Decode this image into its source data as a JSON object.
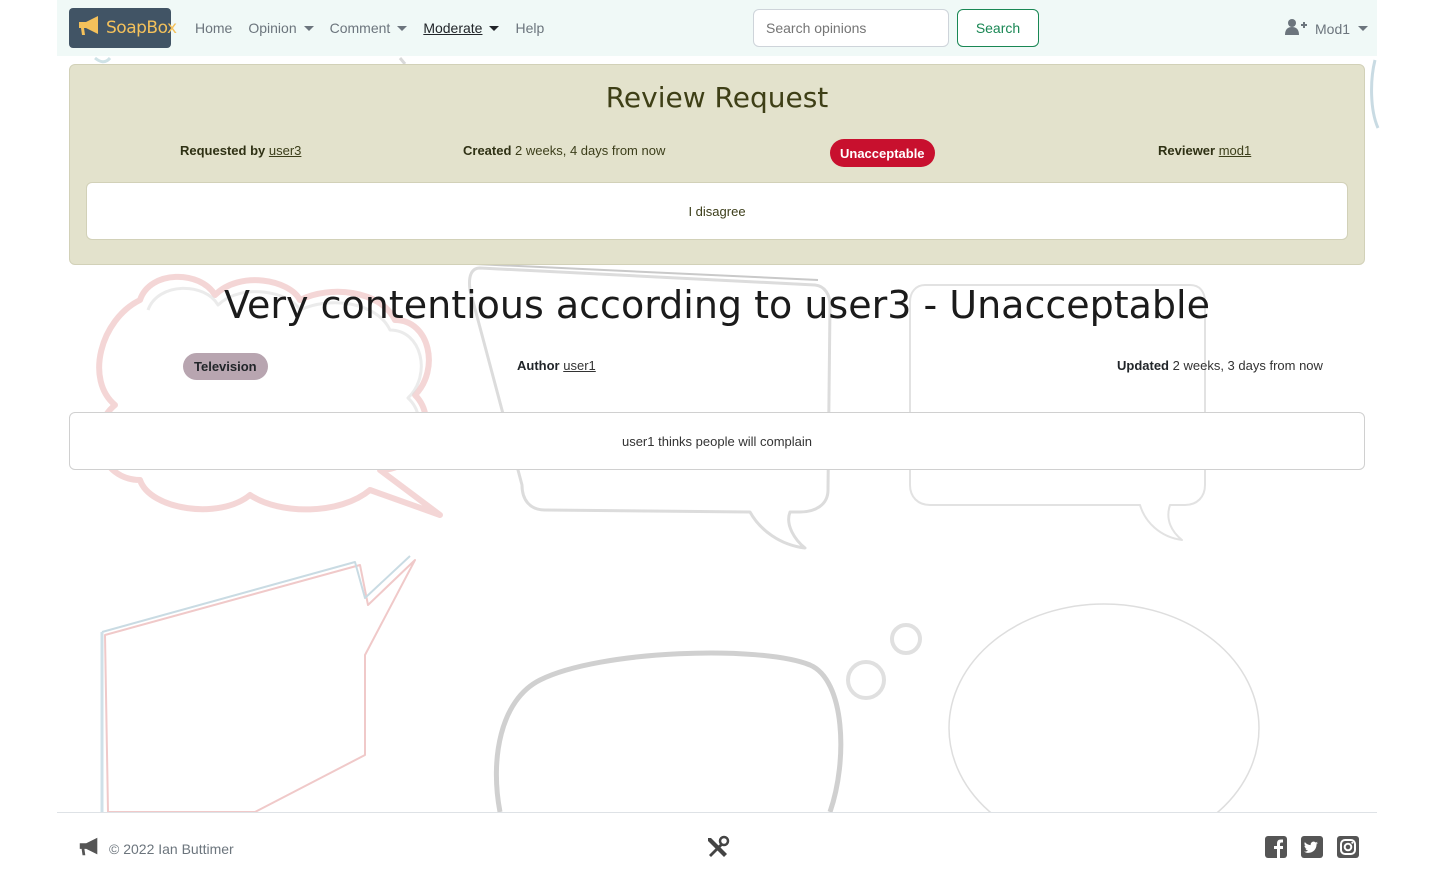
{
  "navbar": {
    "brand": "SoapBox",
    "items": [
      {
        "label": "Home",
        "dropdown": false,
        "active": false
      },
      {
        "label": "Opinion",
        "dropdown": true,
        "active": false
      },
      {
        "label": "Comment",
        "dropdown": true,
        "active": false
      },
      {
        "label": "Moderate",
        "dropdown": true,
        "active": true
      },
      {
        "label": "Help",
        "dropdown": false,
        "active": false
      }
    ],
    "search_placeholder": "Search opinions",
    "search_button": "Search",
    "user": "Mod1"
  },
  "review": {
    "title": "Review Request",
    "requested_by_label": "Requested by",
    "requested_by": "user3",
    "created_label": "Created",
    "created": "2 weeks, 4 days from now",
    "status": "Unacceptable",
    "reviewer_label": "Reviewer",
    "reviewer": "mod1",
    "body": "I disagree"
  },
  "opinion": {
    "title": "Very contentious according to user3 - Unacceptable",
    "tag": "Television",
    "author_label": "Author",
    "author": "user1",
    "updated_label": "Updated",
    "updated": "2 weeks, 3 days from now",
    "body": "user1 thinks people will complain"
  },
  "footer": {
    "copyright": "© 2022 Ian Buttimer"
  },
  "colors": {
    "brand_bg": "#415465",
    "brand_text": "#f4c15b",
    "navbar_bg": "#f0f9f7",
    "review_bg": "#e3e2cc",
    "status_badge": "#c8102e",
    "tag_badge": "#b8a5b0",
    "search_accent": "#198754"
  }
}
